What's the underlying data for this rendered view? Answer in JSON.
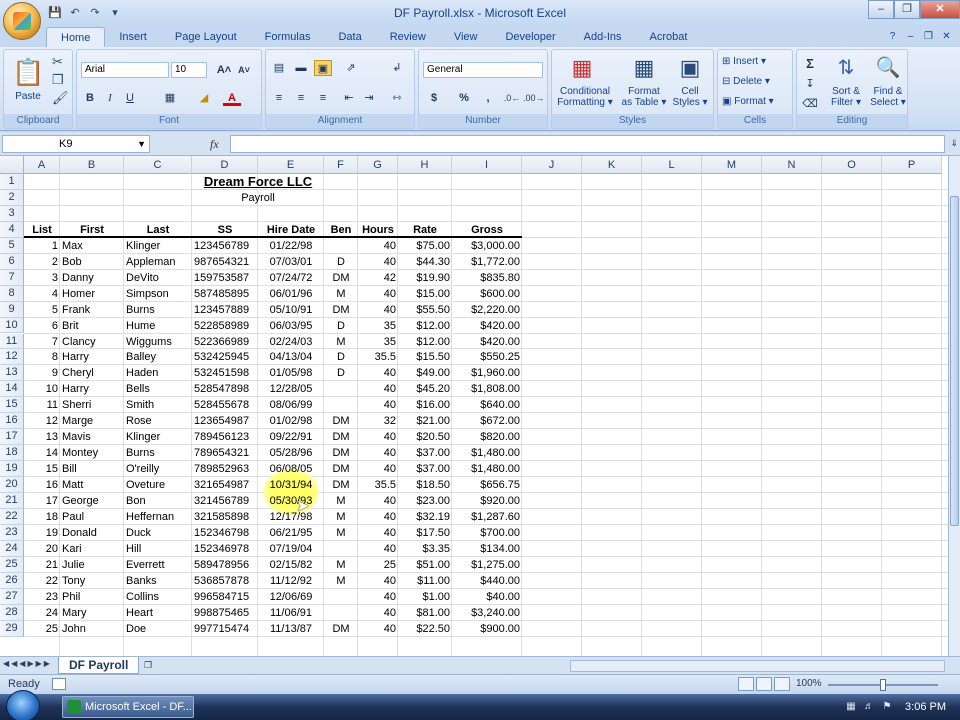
{
  "window": {
    "title": "DF Payroll.xlsx - Microsoft Excel"
  },
  "tabs": [
    "Home",
    "Insert",
    "Page Layout",
    "Formulas",
    "Data",
    "Review",
    "View",
    "Developer",
    "Add-Ins",
    "Acrobat"
  ],
  "ribbon": {
    "clipboard": {
      "label": "Clipboard",
      "paste": "Paste"
    },
    "font": {
      "label": "Font",
      "name": "Arial",
      "size": "10"
    },
    "alignment": {
      "label": "Alignment"
    },
    "number": {
      "label": "Number",
      "format": "General"
    },
    "styles": {
      "label": "Styles",
      "conditional_1": "Conditional",
      "conditional_2": "Formatting",
      "format_table_1": "Format",
      "format_table_2": "as Table",
      "cell_styles_1": "Cell",
      "cell_styles_2": "Styles"
    },
    "cells": {
      "label": "Cells",
      "insert": "Insert",
      "delete": "Delete",
      "format": "Format"
    },
    "editing": {
      "label": "Editing",
      "sort_1": "Sort &",
      "sort_2": "Filter",
      "find_1": "Find &",
      "find_2": "Select"
    }
  },
  "formula_bar": {
    "name_box": "K9",
    "fx": "fx",
    "value": ""
  },
  "columns": [
    "A",
    "B",
    "C",
    "D",
    "E",
    "F",
    "G",
    "H",
    "I",
    "J",
    "K",
    "L",
    "M",
    "N",
    "O",
    "P"
  ],
  "rows": [
    "1",
    "2",
    "3",
    "4",
    "5",
    "6",
    "7",
    "8",
    "9",
    "10",
    "11",
    "12",
    "13",
    "14",
    "15",
    "16",
    "17",
    "18",
    "19",
    "20",
    "21",
    "22",
    "23",
    "24",
    "25",
    "26",
    "27",
    "28",
    "29"
  ],
  "sheet": {
    "title": "Dream Force LLC",
    "subtitle": "Payroll",
    "headers": [
      "List",
      "First",
      "Last",
      "SS",
      "Hire Date",
      "Ben",
      "Hours",
      "Rate",
      "Gross"
    ],
    "records": [
      [
        "1",
        "Max",
        "Klinger",
        "123456789",
        "01/22/98",
        "",
        "40",
        "$75.00",
        "$3,000.00"
      ],
      [
        "2",
        "Bob",
        "Appleman",
        "987654321",
        "07/03/01",
        "D",
        "40",
        "$44.30",
        "$1,772.00"
      ],
      [
        "3",
        "Danny",
        "DeVito",
        "159753587",
        "07/24/72",
        "DM",
        "42",
        "$19.90",
        "$835.80"
      ],
      [
        "4",
        "Homer",
        "Simpson",
        "587485895",
        "06/01/96",
        "M",
        "40",
        "$15.00",
        "$600.00"
      ],
      [
        "5",
        "Frank",
        "Burns",
        "123457889",
        "05/10/91",
        "DM",
        "40",
        "$55.50",
        "$2,220.00"
      ],
      [
        "6",
        "Brit",
        "Hume",
        "522858989",
        "06/03/95",
        "D",
        "35",
        "$12.00",
        "$420.00"
      ],
      [
        "7",
        "Clancy",
        "Wiggums",
        "522366989",
        "02/24/03",
        "M",
        "35",
        "$12.00",
        "$420.00"
      ],
      [
        "8",
        "Harry",
        "Balley",
        "532425945",
        "04/13/04",
        "D",
        "35.5",
        "$15.50",
        "$550.25"
      ],
      [
        "9",
        "Cheryl",
        "Haden",
        "532451598",
        "01/05/98",
        "D",
        "40",
        "$49.00",
        "$1,960.00"
      ],
      [
        "10",
        "Harry",
        "Bells",
        "528547898",
        "12/28/05",
        "",
        "40",
        "$45.20",
        "$1,808.00"
      ],
      [
        "11",
        "Sherri",
        "Smith",
        "528455678",
        "08/06/99",
        "",
        "40",
        "$16.00",
        "$640.00"
      ],
      [
        "12",
        "Marge",
        "Rose",
        "123654987",
        "01/02/98",
        "DM",
        "32",
        "$21.00",
        "$672.00"
      ],
      [
        "13",
        "Mavis",
        "Klinger",
        "789456123",
        "09/22/91",
        "DM",
        "40",
        "$20.50",
        "$820.00"
      ],
      [
        "14",
        "Montey",
        "Burns",
        "789654321",
        "05/28/96",
        "DM",
        "40",
        "$37.00",
        "$1,480.00"
      ],
      [
        "15",
        "Bill",
        "O'reilly",
        "789852963",
        "06/08/05",
        "DM",
        "40",
        "$37.00",
        "$1,480.00"
      ],
      [
        "16",
        "Matt",
        "Oveture",
        "321654987",
        "10/31/94",
        "DM",
        "35.5",
        "$18.50",
        "$656.75"
      ],
      [
        "17",
        "George",
        "Bon",
        "321456789",
        "05/30/93",
        "M",
        "40",
        "$23.00",
        "$920.00"
      ],
      [
        "18",
        "Paul",
        "Heffernan",
        "321585898",
        "12/17/98",
        "M",
        "40",
        "$32.19",
        "$1,287.60"
      ],
      [
        "19",
        "Donald",
        "Duck",
        "152346798",
        "06/21/95",
        "M",
        "40",
        "$17.50",
        "$700.00"
      ],
      [
        "20",
        "Kari",
        "Hill",
        "152346978",
        "07/19/04",
        "",
        "40",
        "$3.35",
        "$134.00"
      ],
      [
        "21",
        "Julie",
        "Everrett",
        "589478956",
        "02/15/82",
        "M",
        "25",
        "$51.00",
        "$1,275.00"
      ],
      [
        "22",
        "Tony",
        "Banks",
        "536857878",
        "11/12/92",
        "M",
        "40",
        "$11.00",
        "$440.00"
      ],
      [
        "23",
        "Phil",
        "Collins",
        "996584715",
        "12/06/69",
        "",
        "40",
        "$1.00",
        "$40.00"
      ],
      [
        "24",
        "Mary",
        "Heart",
        "998875465",
        "11/06/91",
        "",
        "40",
        "$81.00",
        "$3,240.00"
      ],
      [
        "25",
        "John",
        "Doe",
        "997715474",
        "11/13/87",
        "DM",
        "40",
        "$22.50",
        "$900.00"
      ]
    ]
  },
  "sheet_tab": "DF Payroll",
  "status": {
    "ready": "Ready",
    "zoom": "100%"
  },
  "taskbar": {
    "item": "Microsoft Excel - DF...",
    "clock": "3:06 PM"
  }
}
